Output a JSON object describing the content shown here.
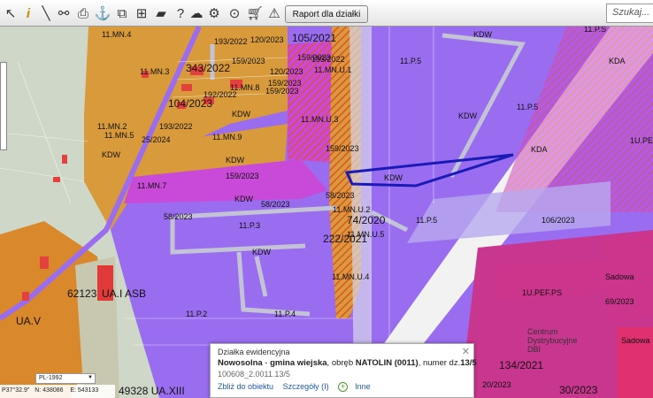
{
  "toolbar": {
    "report_label": "Raport dla działki",
    "search_placeholder": "Szukaj..."
  },
  "map": {
    "labels": {
      "l105_2021": "105/2021",
      "l120_2023": "120/2023",
      "l193_2022a": "193/2022",
      "l159_2023a": "159/2023",
      "l343_2022": "343/2022",
      "l120_2023b": "120/2023",
      "l159_2023b": "159/2023",
      "l193_2022b": "193/2022",
      "l159_2023c": "159/2023",
      "l192_2022": "192/2022",
      "l104_2023": "104/2023",
      "l159_2023d": "159/2023",
      "l193_2022c": "193/2022",
      "l25_2024": "25/2024",
      "l159_2023e": "159/2023",
      "l159_2023f": "159/2023",
      "l58_2023a": "58/2023",
      "l58_2023b": "58/2023",
      "l58_2023c": "58/2023",
      "l74_2020": "74/2020",
      "l222_2021": "222/2021",
      "l106_2023": "106/2023",
      "l69_2023": "69/2023",
      "l134_2021": "134/2021",
      "l30_2023": "30/2023",
      "l20_2023": "20/2023",
      "l62123": "62123",
      "l_uaiasb": "UA.I  ASB",
      "l49328": "49328 UA.XIII",
      "l_uav": "UA.V",
      "z_11mn4": "11.MN.4",
      "z_11mn3": "11.MN.3",
      "z_11mn2": "11.MN.2",
      "z_11mn5": "11.MN.5",
      "z_11mn8": "11.MN.8",
      "z_11mn9": "11.MN.9",
      "z_11mn6": "11.MN.6",
      "z_11mn1": "11.MN.1",
      "z_11p5": "11.P.5",
      "z_11p5b": "11.P.5",
      "z_11p5c": "11.P.5",
      "z_11p3": "11.P.3",
      "z_11p2": "11.P.2",
      "z_11p4": "11.P.4",
      "z_11mn7": "11.MN.7",
      "z_11mnu1": "11.MN.U.1",
      "z_11mnu3": "11.MN.U.3",
      "z_11mnu5": "11.MN.U.5",
      "z_11mnu2": "11.MN.U.2",
      "z_11mnu4": "11.MN.U.4",
      "z_1upefps": "1U.PEF.PS",
      "z_1upef": "1U.PEF",
      "z_11ps": "11.P.S",
      "r_kdw1": "KDW",
      "r_kdw2": "KDW",
      "r_kdw3": "KDW",
      "r_kdw4": "KDW",
      "r_kdw5": "KDW",
      "r_kdw6": "KDW",
      "r_kda": "KDA",
      "r_kda2": "KDA",
      "r_kdw7": "KDW",
      "r_kdw8": "KDW",
      "r_sadowa": "Sadowa",
      "r_sadowa2": "Sadowa",
      "centrum": "Centrum Dystrybucyjne DBI",
      "l11mn": "11.MN",
      "l11p": "11.P.4"
    }
  },
  "popup": {
    "title": "Działka ewidencyjna",
    "parcel_bold1": "Nowosolna",
    "parcel_text1": " - ",
    "parcel_bold2": "gmina wiejska",
    "parcel_text2": ", obręb ",
    "parcel_bold3": "NATOLIN (0011)",
    "parcel_text3": ", numer dz.",
    "parcel_bold4": "13/5",
    "id": "100608_2.0011.13/5",
    "link_zoom": "Zbliż do obiektu",
    "link_details": "Szczegóły (I)",
    "link_other": "Inne"
  },
  "status": {
    "crs": "PL-1992",
    "lat": "P37°32.9\"",
    "n": "N: 438086",
    "e": "E: 543133"
  },
  "colors": {
    "violet": "#9a6df0",
    "orange": "#d89a3a",
    "magenta": "#c94ad8",
    "hatch": "#e0502a",
    "pink": "#e8308a",
    "selection": "#1a1ab8"
  }
}
